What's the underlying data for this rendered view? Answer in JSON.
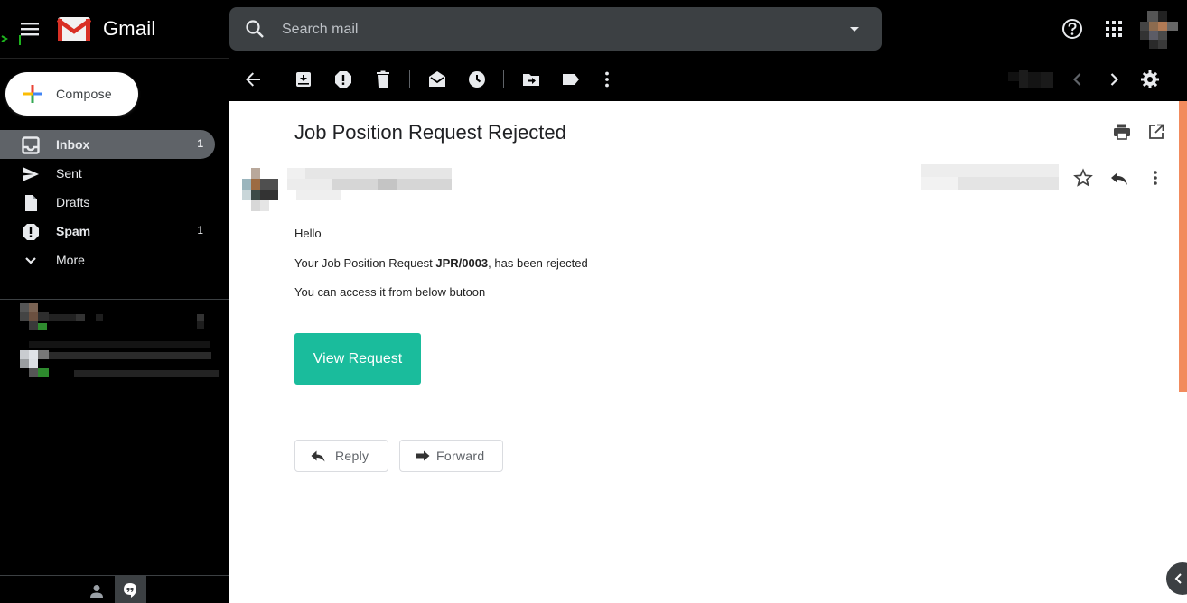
{
  "header": {
    "app_name": "Gmail",
    "search_placeholder": "Search mail",
    "icons": [
      "menu-icon",
      "gmail-logo",
      "search-icon",
      "search-options-icon",
      "help-icon",
      "apps-grid-icon",
      "avatar"
    ]
  },
  "sidebar": {
    "compose_label": "Compose",
    "items": [
      {
        "label": "Inbox",
        "count": "1",
        "icon": "inbox-icon",
        "active": true
      },
      {
        "label": "Sent",
        "count": "",
        "icon": "send-icon"
      },
      {
        "label": "Drafts",
        "count": "",
        "icon": "draft-icon"
      },
      {
        "label": "Spam",
        "count": "1",
        "icon": "spam-icon"
      },
      {
        "label": "More",
        "count": "",
        "icon": "chevron-down-icon"
      }
    ]
  },
  "toolbar": {
    "icons": [
      "back-arrow-icon",
      "archive-icon",
      "report-spam-icon",
      "delete-icon",
      "mark-unread-icon",
      "snooze-icon",
      "move-to-icon",
      "label-icon",
      "more-vert-icon",
      "prev-chevron-icon",
      "next-chevron-icon",
      "settings-gear-icon"
    ]
  },
  "message": {
    "subject": "Job Position Request Rejected",
    "greeting": "Hello",
    "line1_prefix": "Your Job Position Request ",
    "line1_code": "JPR/0003",
    "line1_suffix": ", has been rejected",
    "line2": "You can access it from below butoon",
    "cta_label": "View Request",
    "reply_label": "Reply",
    "forward_label": "Forward"
  },
  "colors": {
    "background": "#000000",
    "pane": "#ffffff",
    "cta": "#1abc9c",
    "active_nav": "#5f6368",
    "scroll_thumb": "#f28b5d"
  }
}
